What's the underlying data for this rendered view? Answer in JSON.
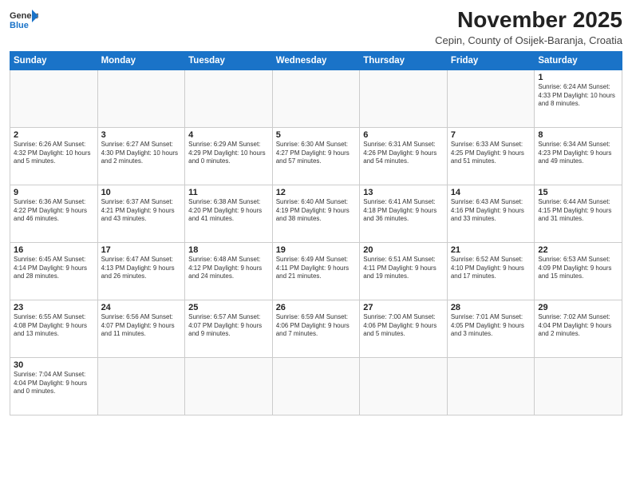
{
  "header": {
    "logo_general": "General",
    "logo_blue": "Blue",
    "month": "November 2025",
    "location": "Cepin, County of Osijek-Baranja, Croatia"
  },
  "weekdays": [
    "Sunday",
    "Monday",
    "Tuesday",
    "Wednesday",
    "Thursday",
    "Friday",
    "Saturday"
  ],
  "weeks": [
    [
      {
        "day": "",
        "info": ""
      },
      {
        "day": "",
        "info": ""
      },
      {
        "day": "",
        "info": ""
      },
      {
        "day": "",
        "info": ""
      },
      {
        "day": "",
        "info": ""
      },
      {
        "day": "",
        "info": ""
      },
      {
        "day": "1",
        "info": "Sunrise: 6:24 AM\nSunset: 4:33 PM\nDaylight: 10 hours\nand 8 minutes."
      }
    ],
    [
      {
        "day": "2",
        "info": "Sunrise: 6:26 AM\nSunset: 4:32 PM\nDaylight: 10 hours\nand 5 minutes."
      },
      {
        "day": "3",
        "info": "Sunrise: 6:27 AM\nSunset: 4:30 PM\nDaylight: 10 hours\nand 2 minutes."
      },
      {
        "day": "4",
        "info": "Sunrise: 6:29 AM\nSunset: 4:29 PM\nDaylight: 10 hours\nand 0 minutes."
      },
      {
        "day": "5",
        "info": "Sunrise: 6:30 AM\nSunset: 4:27 PM\nDaylight: 9 hours\nand 57 minutes."
      },
      {
        "day": "6",
        "info": "Sunrise: 6:31 AM\nSunset: 4:26 PM\nDaylight: 9 hours\nand 54 minutes."
      },
      {
        "day": "7",
        "info": "Sunrise: 6:33 AM\nSunset: 4:25 PM\nDaylight: 9 hours\nand 51 minutes."
      },
      {
        "day": "8",
        "info": "Sunrise: 6:34 AM\nSunset: 4:23 PM\nDaylight: 9 hours\nand 49 minutes."
      }
    ],
    [
      {
        "day": "9",
        "info": "Sunrise: 6:36 AM\nSunset: 4:22 PM\nDaylight: 9 hours\nand 46 minutes."
      },
      {
        "day": "10",
        "info": "Sunrise: 6:37 AM\nSunset: 4:21 PM\nDaylight: 9 hours\nand 43 minutes."
      },
      {
        "day": "11",
        "info": "Sunrise: 6:38 AM\nSunset: 4:20 PM\nDaylight: 9 hours\nand 41 minutes."
      },
      {
        "day": "12",
        "info": "Sunrise: 6:40 AM\nSunset: 4:19 PM\nDaylight: 9 hours\nand 38 minutes."
      },
      {
        "day": "13",
        "info": "Sunrise: 6:41 AM\nSunset: 4:18 PM\nDaylight: 9 hours\nand 36 minutes."
      },
      {
        "day": "14",
        "info": "Sunrise: 6:43 AM\nSunset: 4:16 PM\nDaylight: 9 hours\nand 33 minutes."
      },
      {
        "day": "15",
        "info": "Sunrise: 6:44 AM\nSunset: 4:15 PM\nDaylight: 9 hours\nand 31 minutes."
      }
    ],
    [
      {
        "day": "16",
        "info": "Sunrise: 6:45 AM\nSunset: 4:14 PM\nDaylight: 9 hours\nand 28 minutes."
      },
      {
        "day": "17",
        "info": "Sunrise: 6:47 AM\nSunset: 4:13 PM\nDaylight: 9 hours\nand 26 minutes."
      },
      {
        "day": "18",
        "info": "Sunrise: 6:48 AM\nSunset: 4:12 PM\nDaylight: 9 hours\nand 24 minutes."
      },
      {
        "day": "19",
        "info": "Sunrise: 6:49 AM\nSunset: 4:11 PM\nDaylight: 9 hours\nand 21 minutes."
      },
      {
        "day": "20",
        "info": "Sunrise: 6:51 AM\nSunset: 4:11 PM\nDaylight: 9 hours\nand 19 minutes."
      },
      {
        "day": "21",
        "info": "Sunrise: 6:52 AM\nSunset: 4:10 PM\nDaylight: 9 hours\nand 17 minutes."
      },
      {
        "day": "22",
        "info": "Sunrise: 6:53 AM\nSunset: 4:09 PM\nDaylight: 9 hours\nand 15 minutes."
      }
    ],
    [
      {
        "day": "23",
        "info": "Sunrise: 6:55 AM\nSunset: 4:08 PM\nDaylight: 9 hours\nand 13 minutes."
      },
      {
        "day": "24",
        "info": "Sunrise: 6:56 AM\nSunset: 4:07 PM\nDaylight: 9 hours\nand 11 minutes."
      },
      {
        "day": "25",
        "info": "Sunrise: 6:57 AM\nSunset: 4:07 PM\nDaylight: 9 hours\nand 9 minutes."
      },
      {
        "day": "26",
        "info": "Sunrise: 6:59 AM\nSunset: 4:06 PM\nDaylight: 9 hours\nand 7 minutes."
      },
      {
        "day": "27",
        "info": "Sunrise: 7:00 AM\nSunset: 4:06 PM\nDaylight: 9 hours\nand 5 minutes."
      },
      {
        "day": "28",
        "info": "Sunrise: 7:01 AM\nSunset: 4:05 PM\nDaylight: 9 hours\nand 3 minutes."
      },
      {
        "day": "29",
        "info": "Sunrise: 7:02 AM\nSunset: 4:04 PM\nDaylight: 9 hours\nand 2 minutes."
      }
    ],
    [
      {
        "day": "30",
        "info": "Sunrise: 7:04 AM\nSunset: 4:04 PM\nDaylight: 9 hours\nand 0 minutes."
      },
      {
        "day": "",
        "info": ""
      },
      {
        "day": "",
        "info": ""
      },
      {
        "day": "",
        "info": ""
      },
      {
        "day": "",
        "info": ""
      },
      {
        "day": "",
        "info": ""
      },
      {
        "day": "",
        "info": ""
      }
    ]
  ]
}
